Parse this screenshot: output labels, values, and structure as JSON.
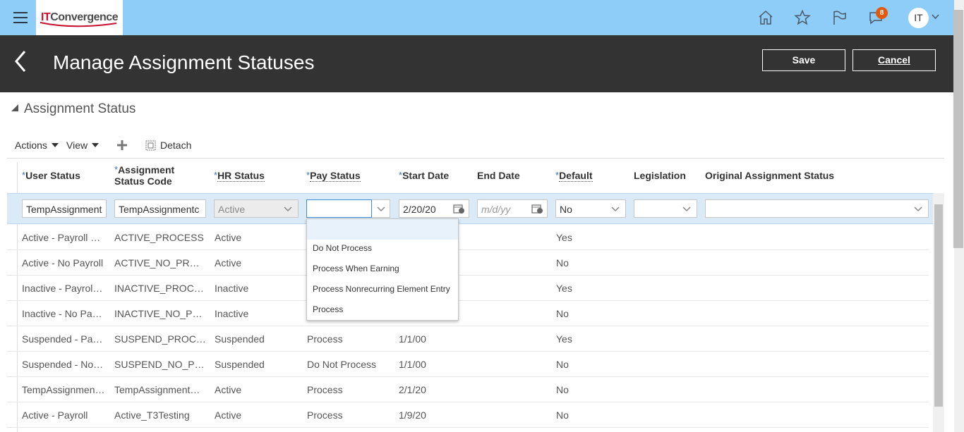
{
  "header": {
    "logo_prefix": "IT",
    "logo_name": "Convergence",
    "notification_count": "8",
    "user_initials": "IT",
    "icons": [
      "home-icon",
      "favorites-star-icon",
      "watchlist-flag-icon",
      "notifications-icon"
    ]
  },
  "page": {
    "title": "Manage Assignment Statuses",
    "save_label": "Save",
    "cancel_label": "Cancel"
  },
  "section": {
    "title": "Assignment Status"
  },
  "toolbar": {
    "actions_label": "Actions",
    "view_label": "View",
    "detach_label": "Detach"
  },
  "columns": {
    "user_status": "User Status",
    "code_line1": "Assignment",
    "code_line2": "Status Code",
    "hr_status": "HR Status",
    "pay_status": "Pay Status",
    "start_date": "Start Date",
    "end_date": "End Date",
    "default": "Default",
    "legislation": "Legislation",
    "original_status": "Original Assignment Status",
    "required_mark": "*"
  },
  "edit_row": {
    "user_status": "TempAssignment",
    "code": "TempAssignmentc",
    "hr_status": "Active",
    "pay_status": "",
    "start_date": "2/20/20",
    "end_date_placeholder": "m/d/yy",
    "default": "No",
    "legislation": "",
    "original_status": ""
  },
  "pay_status_options": [
    "",
    "Do Not Process",
    "Process When Earning",
    "Process Nonrecurring Element Entry",
    "Process"
  ],
  "rows": [
    {
      "user_status": "Active - Payroll …",
      "code": "ACTIVE_PROCESS",
      "hr": "Active",
      "pay": "",
      "start": "",
      "default": "Yes"
    },
    {
      "user_status": "Active - No Payroll",
      "code": "ACTIVE_NO_PROC…",
      "hr": "Active",
      "pay": "",
      "start": "",
      "default": "No"
    },
    {
      "user_status": "Inactive - Payrol…",
      "code": "INACTIVE_PROCESS",
      "hr": "Inactive",
      "pay": "",
      "start": "",
      "default": "Yes"
    },
    {
      "user_status": "Inactive - No Pa…",
      "code": "INACTIVE_NO_PR…",
      "hr": "Inactive",
      "pay": "",
      "start": "",
      "default": "No"
    },
    {
      "user_status": "Suspended - Pa…",
      "code": "SUSPEND_PROCESS",
      "hr": "Suspended",
      "pay": "Process",
      "start": "1/1/00",
      "default": "Yes"
    },
    {
      "user_status": "Suspended - No…",
      "code": "SUSPEND_NO_PR…",
      "hr": "Suspended",
      "pay": "Do Not Process",
      "start": "1/1/00",
      "default": "No"
    },
    {
      "user_status": "TempAssignmen…",
      "code": "TempAssignment…",
      "hr": "Active",
      "pay": "Process",
      "start": "2/1/20",
      "default": "No"
    },
    {
      "user_status": "Active - Payroll",
      "code": "Active_T3Testing",
      "hr": "Active",
      "pay": "Process",
      "start": "1/9/20",
      "default": "No"
    }
  ]
}
